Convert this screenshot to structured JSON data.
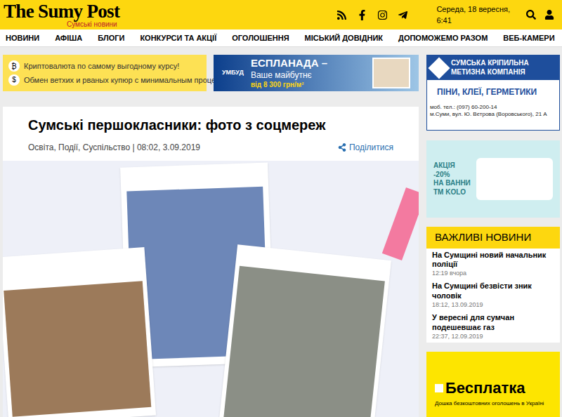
{
  "header": {
    "logo": "The Sumy Post",
    "subtitle": "Сумські новини",
    "date": "Середа, 18 вересня, 6:41"
  },
  "nav": [
    {
      "label": "НОВИНИ"
    },
    {
      "label": "АФІША"
    },
    {
      "label": "БЛОГИ"
    },
    {
      "label": "КОНКУРСИ ТА АКЦІЇ"
    },
    {
      "label": "ОГОЛОШЕННЯ"
    },
    {
      "label": "МІСЬКИЙ ДОВІДНИК"
    },
    {
      "label": "ДОПОМОЖЕМО РАЗОМ"
    },
    {
      "label": "ВЕБ-КАМЕРИ"
    }
  ],
  "ads": {
    "crypto": [
      {
        "icon": "₿",
        "text": "Криптовалюта по самому выгодному курсу!"
      },
      {
        "icon": "$",
        "text": "Обмен ветхих и рваных купюр с минимальным процентом!"
      }
    ],
    "esplanada": {
      "brand": "УМБУД",
      "title": "ЕСПЛАНАДА –",
      "line": "Ваше майбутнє",
      "price": "від 8 300 грн/м²"
    },
    "fasteners": {
      "title": "СУМСЬКА КРІПИЛЬНА МЕТИЗНА КОМПАНІЯ",
      "products": "ПІНИ, КЛЕЇ, ГЕРМЕТИКИ",
      "phone": "моб. тел.: (097) 60-200-14",
      "address": "м.Суми, вул. Ю. Вєтрова (Воровського), 21 А"
    },
    "bath": {
      "lines": [
        "АКЦІЯ",
        "-20%",
        "НА ВАННИ",
        "ТМ KOLO"
      ]
    },
    "besplatka": {
      "title": "Бесплатка",
      "subtitle": "Дошка безкоштовних оголошень в Україні"
    }
  },
  "article": {
    "title": "Сумські першокласники: фото з соцмереж",
    "meta": "Освіта, Події, Суспільство | 08:02, 3.09.2019",
    "share": "Поділитися"
  },
  "important": {
    "title": "ВАЖЛИВІ НОВИНИ",
    "items": [
      {
        "title": "На Сумщині новий начальник поліції",
        "time": "12:19 вчора"
      },
      {
        "title": "На Сумщині безвісти зник чоловік",
        "time": "18:12, 13.09.2019"
      },
      {
        "title": "У вересні для сумчан подешевшає газ",
        "time": "22:37, 12.09.2019"
      }
    ]
  }
}
